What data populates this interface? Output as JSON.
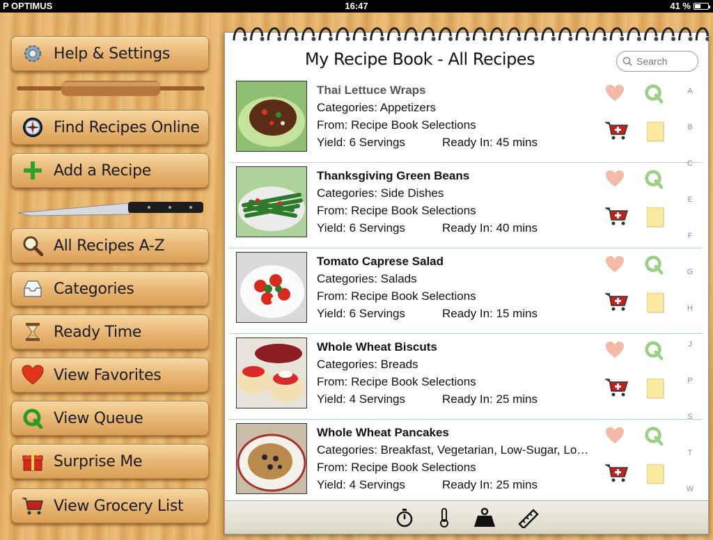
{
  "status": {
    "carrier": "P OPTIMUS",
    "time": "16:47",
    "battery": "41 %"
  },
  "sidebar": {
    "items": [
      {
        "label": "Help & Settings",
        "icon": "gear-icon"
      },
      {
        "label": "Find Recipes Online",
        "icon": "compass-icon"
      },
      {
        "label": "Add a Recipe",
        "icon": "plus-icon"
      },
      {
        "label": "All Recipes A-Z",
        "icon": "magnifier-icon"
      },
      {
        "label": "Categories",
        "icon": "inbox-icon"
      },
      {
        "label": "Ready Time",
        "icon": "hourglass-icon"
      },
      {
        "label": "View Favorites",
        "icon": "heart-icon"
      },
      {
        "label": "View Queue",
        "icon": "queue-icon"
      },
      {
        "label": "Surprise Me",
        "icon": "gift-icon"
      },
      {
        "label": "View Grocery List",
        "icon": "cart-icon"
      }
    ]
  },
  "book": {
    "title": "My Recipe Book - All Recipes",
    "search_placeholder": "Search",
    "recipes": [
      {
        "title": "Thai Lettuce Wraps",
        "categories": "Categories: Appetizers",
        "from": "From: Recipe Book Selections",
        "yield": "Yield: 6 Servings",
        "ready": "Ready In: 45 mins"
      },
      {
        "title": "Thanksgiving Green Beans",
        "categories": "Categories: Side Dishes",
        "from": "From: Recipe Book Selections",
        "yield": "Yield: 6 Servings",
        "ready": "Ready In: 40 mins"
      },
      {
        "title": "Tomato Caprese Salad",
        "categories": "Categories: Salads",
        "from": "From: Recipe Book Selections",
        "yield": "Yield: 6 Servings",
        "ready": "Ready In: 15 mins"
      },
      {
        "title": "Whole Wheat Biscuts",
        "categories": "Categories: Breads",
        "from": "From: Recipe Book Selections",
        "yield": "Yield: 4 Servings",
        "ready": "Ready In: 25 mins"
      },
      {
        "title": "Whole Wheat Pancakes",
        "categories": "Categories: Breakfast, Vegetarian, Low-Sugar, Lo…",
        "from": "From: Recipe Book Selections",
        "yield": "Yield: 4 Servings",
        "ready": "Ready In: 25 mins"
      }
    ],
    "index_letters": [
      "A",
      "B",
      "C",
      "E",
      "F",
      "G",
      "H",
      "J",
      "P",
      "S",
      "T",
      "W"
    ],
    "toolbar": [
      "timer-icon",
      "thermometer-icon",
      "weight-icon",
      "ruler-icon"
    ]
  },
  "colors": {
    "wood": "#e6b36a",
    "divider": "#a9d0e6",
    "heart": "#f3b3a6",
    "queue": "#9ccf86"
  }
}
